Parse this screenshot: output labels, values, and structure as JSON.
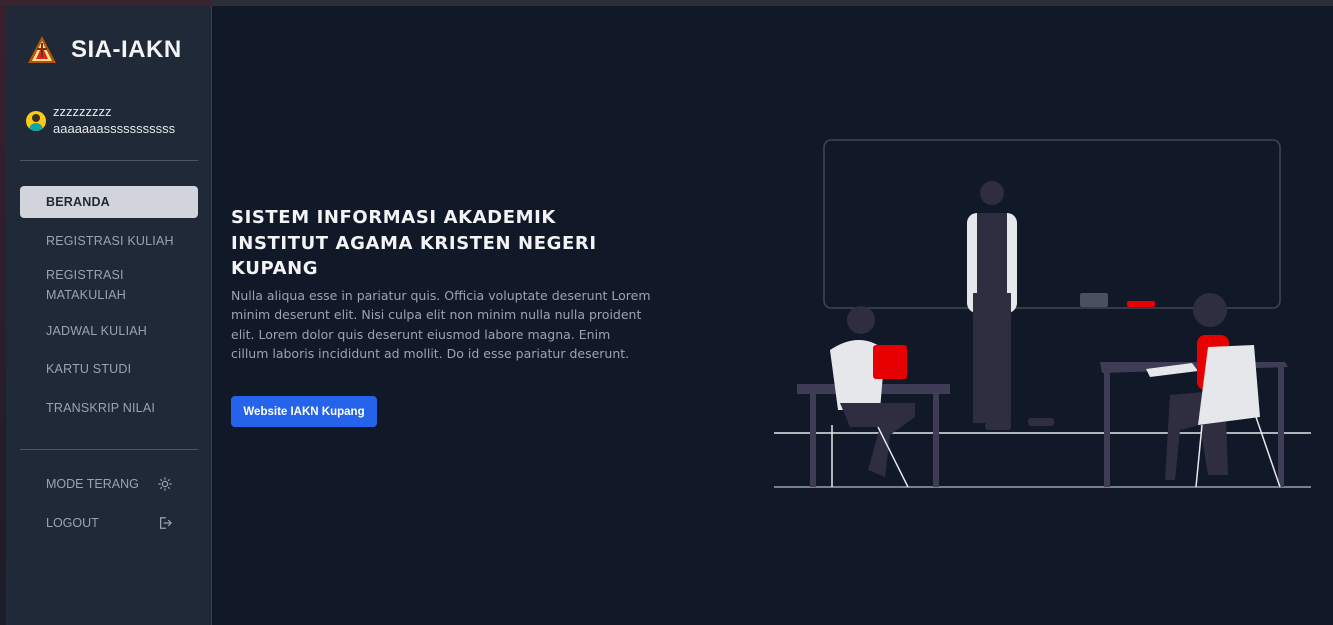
{
  "brand": {
    "name": "SIA-IAKN",
    "logo_icon": "iakn-logo-icon"
  },
  "user": {
    "name": "zzzzzzzzz",
    "subtitle": "aaaaaaasssssssssss",
    "avatar_icon": "user-avatar-icon"
  },
  "nav": {
    "items": [
      {
        "label": "BERANDA",
        "active": true
      },
      {
        "label": "REGISTRASI KULIAH",
        "active": false
      },
      {
        "label": "REGISTRASI MATAKULIAH",
        "active": false
      },
      {
        "label": "JADWAL KULIAH",
        "active": false
      },
      {
        "label": "KARTU STUDI",
        "active": false
      },
      {
        "label": "TRANSKRIP NILAI",
        "active": false
      }
    ],
    "mode_label": "MODE TERANG",
    "mode_icon": "sun-icon",
    "logout_label": "LOGOUT",
    "logout_icon": "logout-icon"
  },
  "hero": {
    "title": "SISTEM INFORMASI AKADEMIK INSTITUT AGAMA KRISTEN NEGERI KUPANG",
    "description": "Nulla aliqua esse in pariatur quis. Officia voluptate deserunt Lorem minim deserunt elit. Nisi culpa elit non minim nulla nulla proident elit. Lorem dolor quis deserunt eiusmod labore magna. Enim cillum laboris incididunt ad mollit. Do id esse pariatur deserunt.",
    "button_label": "Website IAKN Kupang",
    "illustration_icon": "classroom-illustration"
  },
  "colors": {
    "background": "#111827",
    "sidebar": "#1f2937",
    "accent": "#2563eb",
    "highlight": "#ff0000"
  }
}
